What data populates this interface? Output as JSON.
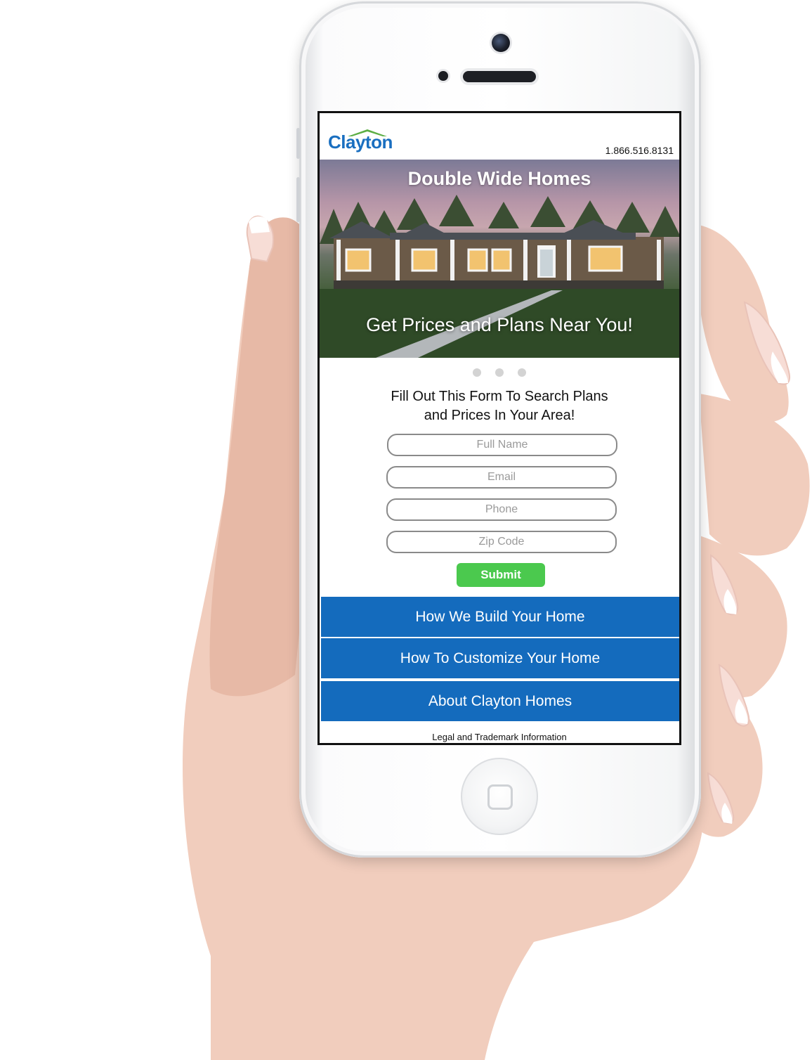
{
  "brand": {
    "logo_text": "Clayton",
    "phone_number": "1.866.516.8131",
    "brand_blue": "#146bbd",
    "roof_green": "#5cae44"
  },
  "hero": {
    "title": "Double Wide Homes",
    "subtitle": "Get Prices and Plans Near You!"
  },
  "carousel": {
    "slide_count": 3
  },
  "form": {
    "heading_line1": "Fill Out This Form To Search Plans",
    "heading_line2": "and Prices In Your Area!",
    "full_name_placeholder": "Full Name",
    "email_placeholder": "Email",
    "phone_placeholder": "Phone",
    "zip_placeholder": "Zip Code",
    "submit_label": "Submit",
    "submit_color": "#4bc94e"
  },
  "nav": {
    "items": [
      {
        "label": "How We Build Your Home"
      },
      {
        "label": "How To Customize Your Home"
      },
      {
        "label": "About Clayton Homes"
      }
    ]
  },
  "footer": {
    "legal_link": "Legal and Trademark Information"
  }
}
